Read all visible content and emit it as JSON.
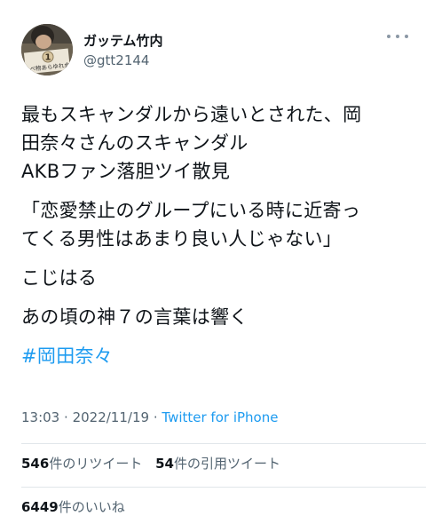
{
  "tweet": {
    "author": {
      "display_name": "ガッテム竹内",
      "handle": "@gtt2144",
      "avatar_badge": "1",
      "avatar_caption": "たべ物あらゆれ会"
    },
    "body": {
      "para1": [
        "最もスキャンダルから遠いとされた、岡",
        "田奈々さんのスキャンダル",
        "AKBファン落胆ツイ散見"
      ],
      "para2": [
        "「恋愛禁止のグループにいる時に近寄っ",
        "てくる男性はあまり良い人じゃない」"
      ],
      "para3": "こじはる",
      "para4": "あの頃の神７の言葉は響く",
      "hashtag": "#岡田奈々"
    },
    "time": "13:03",
    "separator": "·",
    "date": "2022/11/19",
    "source": "Twitter for iPhone",
    "stats": {
      "retweets_count": "546",
      "retweets_label": "件のリツイート",
      "quotes_count": "54",
      "quotes_label": "件の引用ツイート",
      "likes_count": "6449",
      "likes_label": "件のいいね"
    }
  },
  "colors": {
    "text": "#0f1419",
    "secondary": "#536471",
    "link": "#1d9bf0",
    "divider": "#e1e6ea"
  }
}
